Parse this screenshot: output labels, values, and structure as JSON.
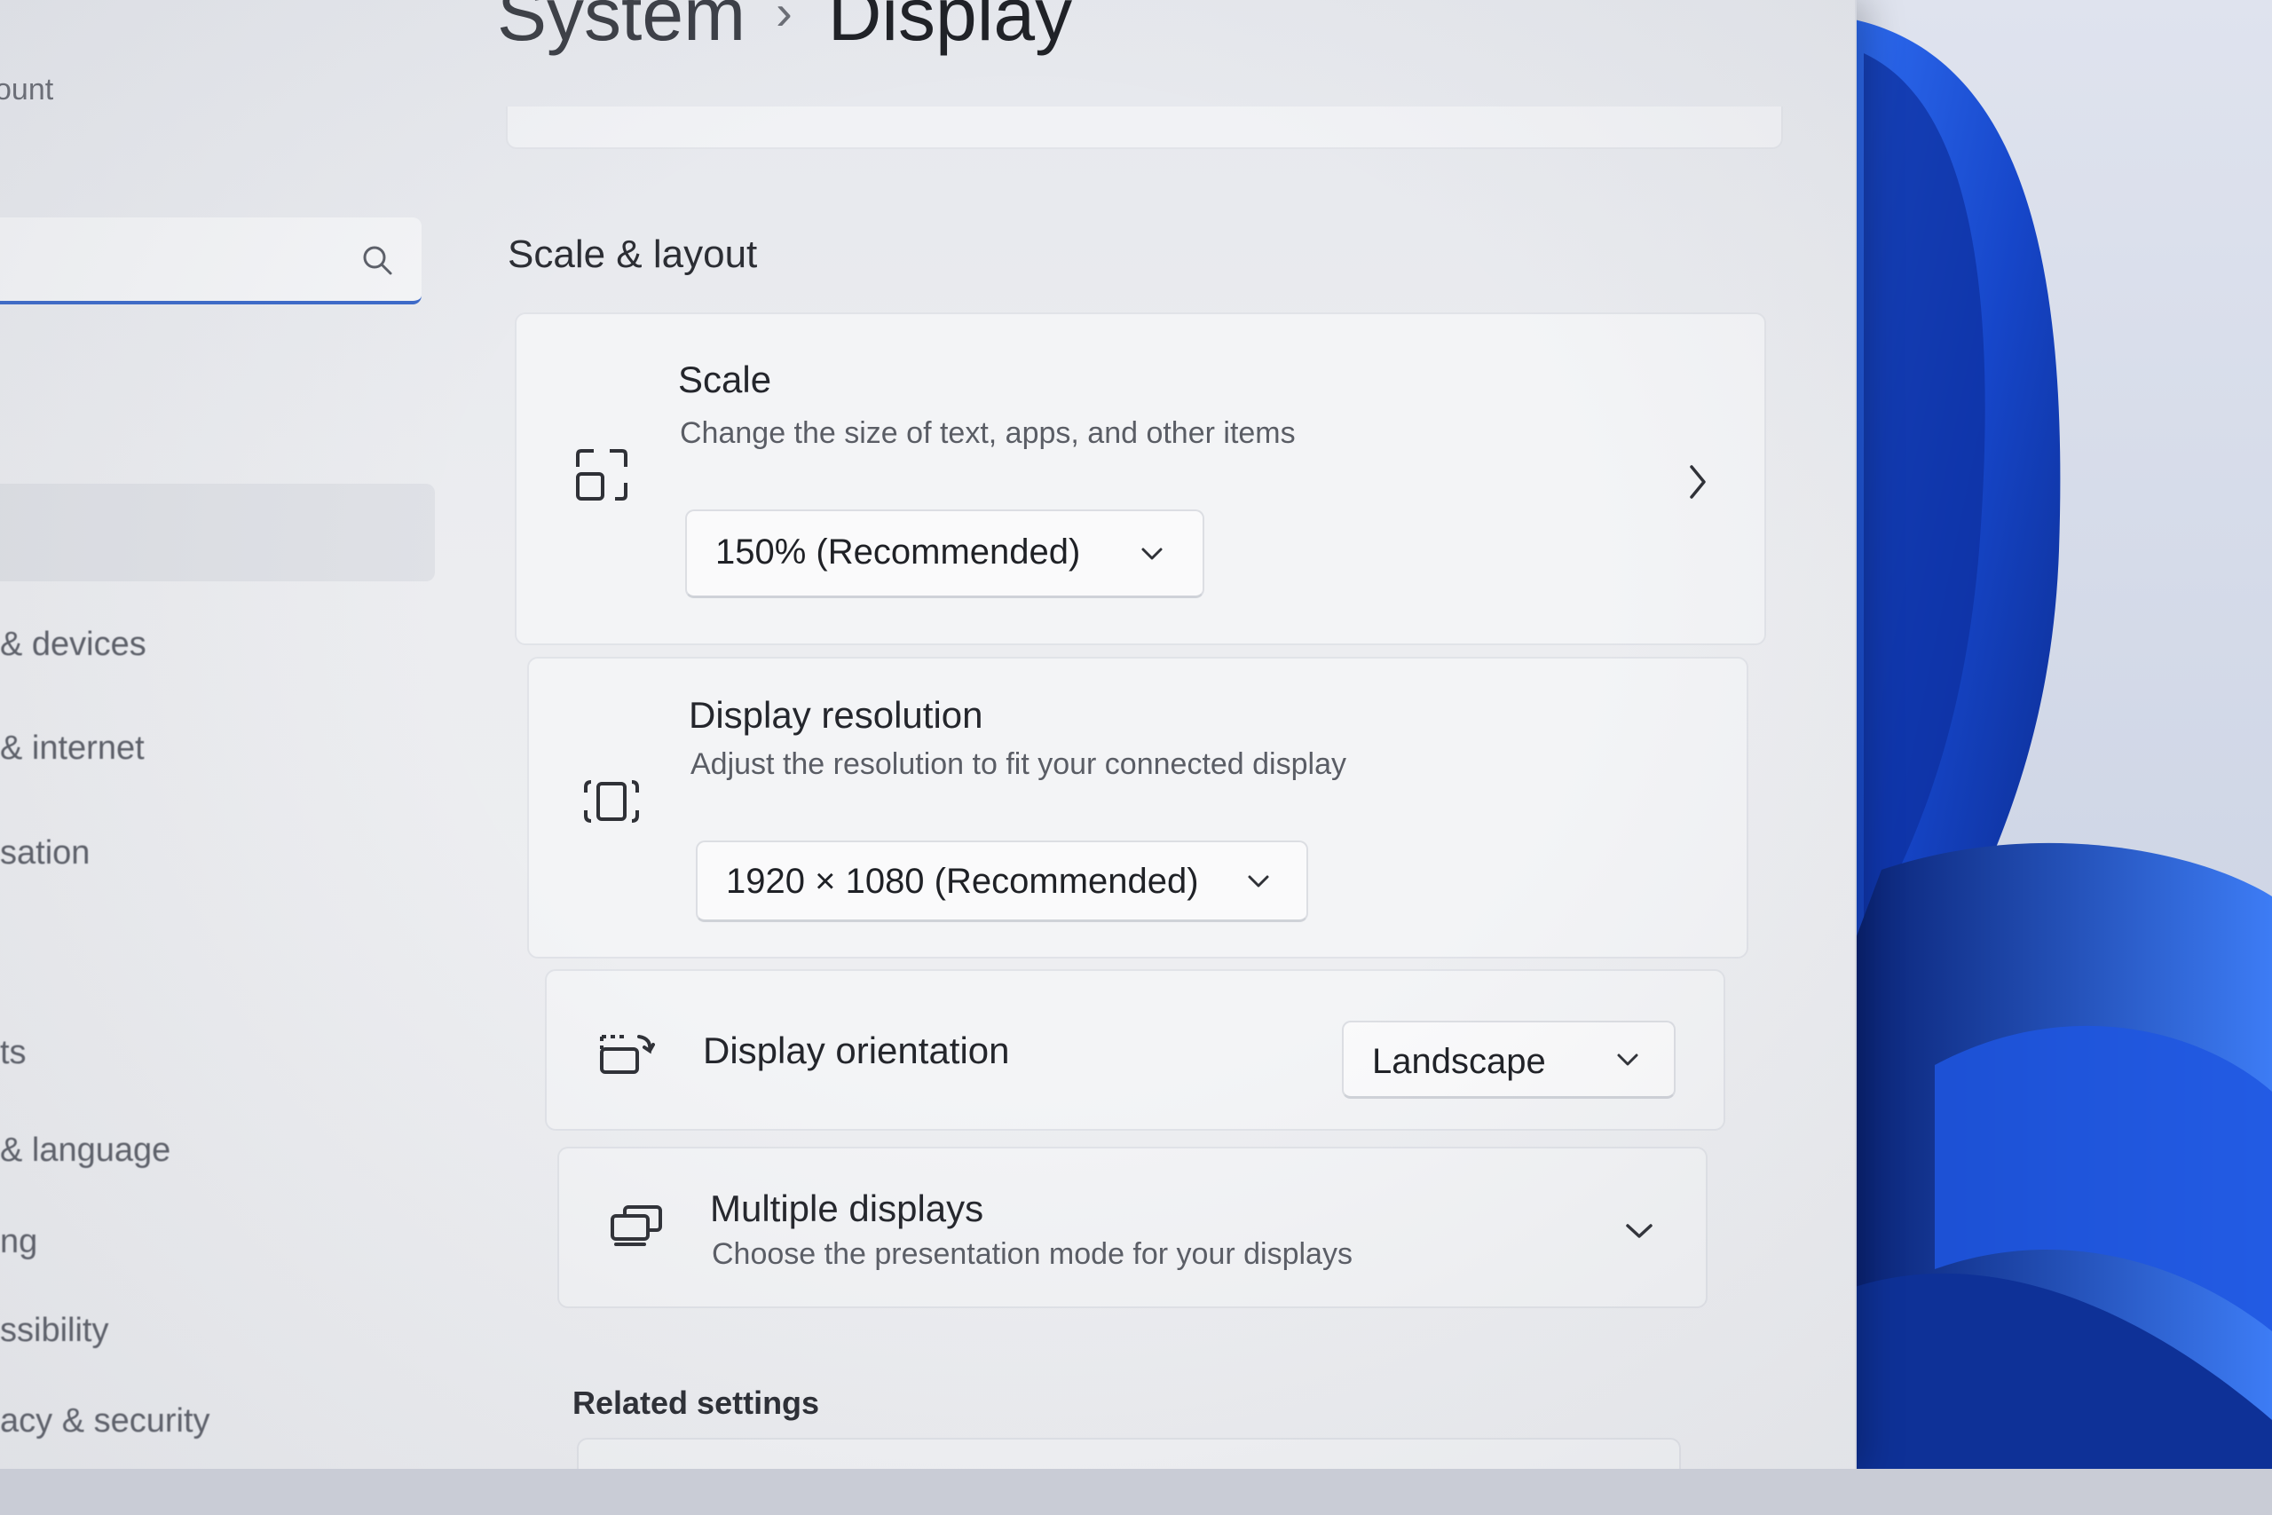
{
  "sidebar": {
    "account_label": "ount",
    "search": {
      "placeholder": ""
    },
    "items": [
      {
        "label": "& devices"
      },
      {
        "label": "& internet"
      },
      {
        "label": "sation"
      },
      {
        "label": "ts"
      },
      {
        "label": "& language"
      },
      {
        "label": "ng"
      },
      {
        "label": "ssibility"
      },
      {
        "label": "acy & security"
      }
    ]
  },
  "header": {
    "breadcrumb_parent": "System",
    "breadcrumb_separator": "›",
    "breadcrumb_current": "Display"
  },
  "scale_layout": {
    "section_title": "Scale & layout",
    "scale": {
      "title": "Scale",
      "subtitle": "Change the size of text, apps, and other items",
      "value": "150% (Recommended)",
      "icon": "scale-icon"
    },
    "resolution": {
      "title": "Display resolution",
      "subtitle": "Adjust the resolution to fit your connected display",
      "value": "1920 × 1080 (Recommended)",
      "icon": "resolution-icon"
    },
    "orientation": {
      "title": "Display orientation",
      "value": "Landscape",
      "icon": "orientation-icon"
    },
    "multiple_displays": {
      "title": "Multiple displays",
      "subtitle": "Choose the presentation mode for your displays",
      "icon": "multiple-displays-icon"
    }
  },
  "related": {
    "title": "Related settings"
  },
  "colors": {
    "accent": "#3c6ac9",
    "wallpaper_blue": "#1e4fd8"
  }
}
